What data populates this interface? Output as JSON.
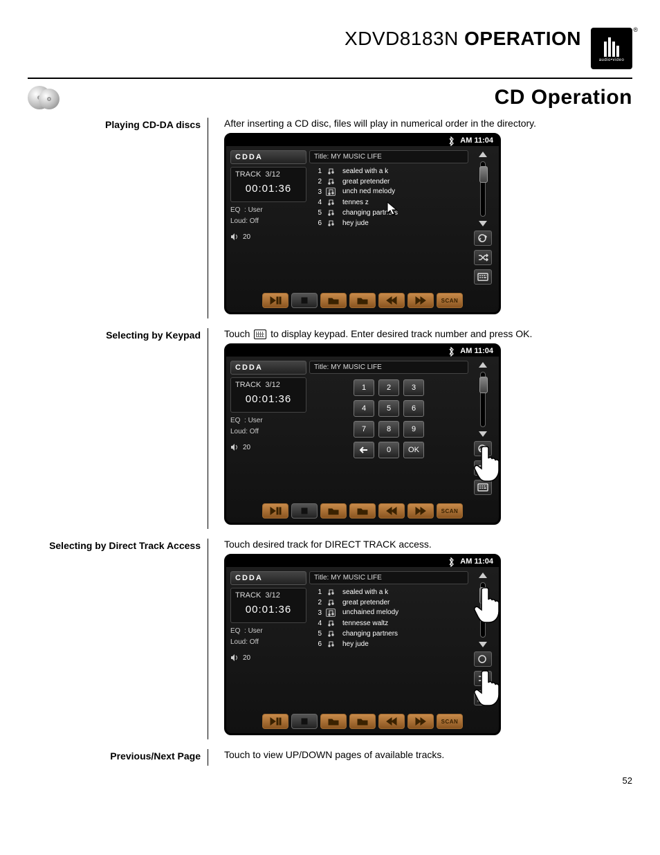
{
  "header": {
    "model": "XDVD8183N",
    "title_suffix": "OPERATION",
    "logo_sub": "audio•video"
  },
  "section_title": "CD Operation",
  "rows": {
    "r1": {
      "label": "Playing CD-DA discs",
      "text": "After inserting a CD disc, files will play in numerical order in the directory."
    },
    "r2": {
      "label": "Selecting by Keypad",
      "text_a": "Touch",
      "text_b": "to display keypad. Enter desired track number and press OK."
    },
    "r3": {
      "label": "Selecting by Direct Track Access",
      "text": "Touch desired track for DIRECT TRACK access."
    },
    "r4": {
      "label": "Previous/Next Page",
      "text": "Touch to view UP/DOWN pages of available tracks."
    }
  },
  "device": {
    "clock": "AM 11:04",
    "mode": "CDDA",
    "track_label": "TRACK",
    "track_pos": "3/12",
    "elapsed": "00:01:36",
    "eq_label": "EQ",
    "eq_value": ": User",
    "loud_label": "Loud",
    "loud_value": ": Off",
    "volume": "20",
    "title_prefix": "Title:",
    "title_value": "MY  MUSIC  LIFE",
    "tracks": [
      {
        "n": "1",
        "name": "sealed with a k"
      },
      {
        "n": "2",
        "name": "great pretender"
      },
      {
        "n": "3",
        "name": "unchained melody"
      },
      {
        "n": "4",
        "name": "tennesse waltz"
      },
      {
        "n": "5",
        "name": "changing partners"
      },
      {
        "n": "6",
        "name": "hey jude"
      }
    ],
    "tracks_alt3": "unch    ned melody",
    "tracks_alt4": "tennes       z",
    "keypad": [
      "1",
      "2",
      "3",
      "4",
      "5",
      "6",
      "7",
      "8",
      "9",
      "←",
      "0",
      "OK"
    ],
    "scan_label": "SCAN"
  },
  "page_number": "52"
}
